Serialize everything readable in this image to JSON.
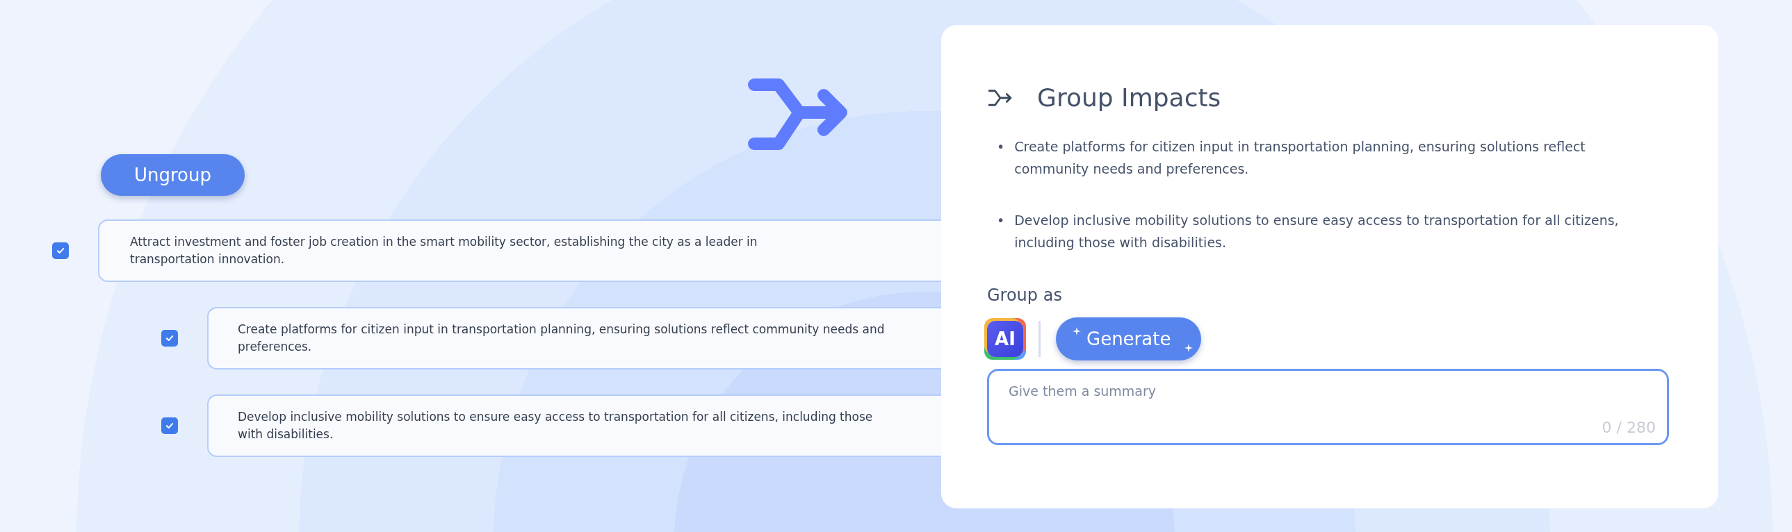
{
  "ungroup_button": {
    "label": "Ungroup"
  },
  "impacts": [
    {
      "text": "Attract investment and foster job creation in the smart mobility sector, establishing the city as a leader in transportation innovation.",
      "checked": true,
      "children": [
        {
          "text": "Create platforms for citizen input in transportation planning, ensuring solutions reflect community needs and preferences.",
          "checked": true
        },
        {
          "text": "Develop inclusive mobility solutions to ensure easy access to transportation for all citizens, including those with disabilities.",
          "checked": true
        }
      ]
    }
  ],
  "panel": {
    "title": "Group Impacts",
    "bullets": [
      "Create platforms for citizen input in transportation planning, ensuring solutions reflect community needs and preferences.",
      "Develop inclusive mobility solutions to ensure easy access to transportation for all citizens, including those with disabilities."
    ],
    "bullet_marker": "•",
    "group_as_label": "Group as",
    "ai_badge": "AI",
    "generate_button": "Generate",
    "summary_field": {
      "placeholder": "Give them a summary",
      "counter": "0 / 280"
    }
  }
}
